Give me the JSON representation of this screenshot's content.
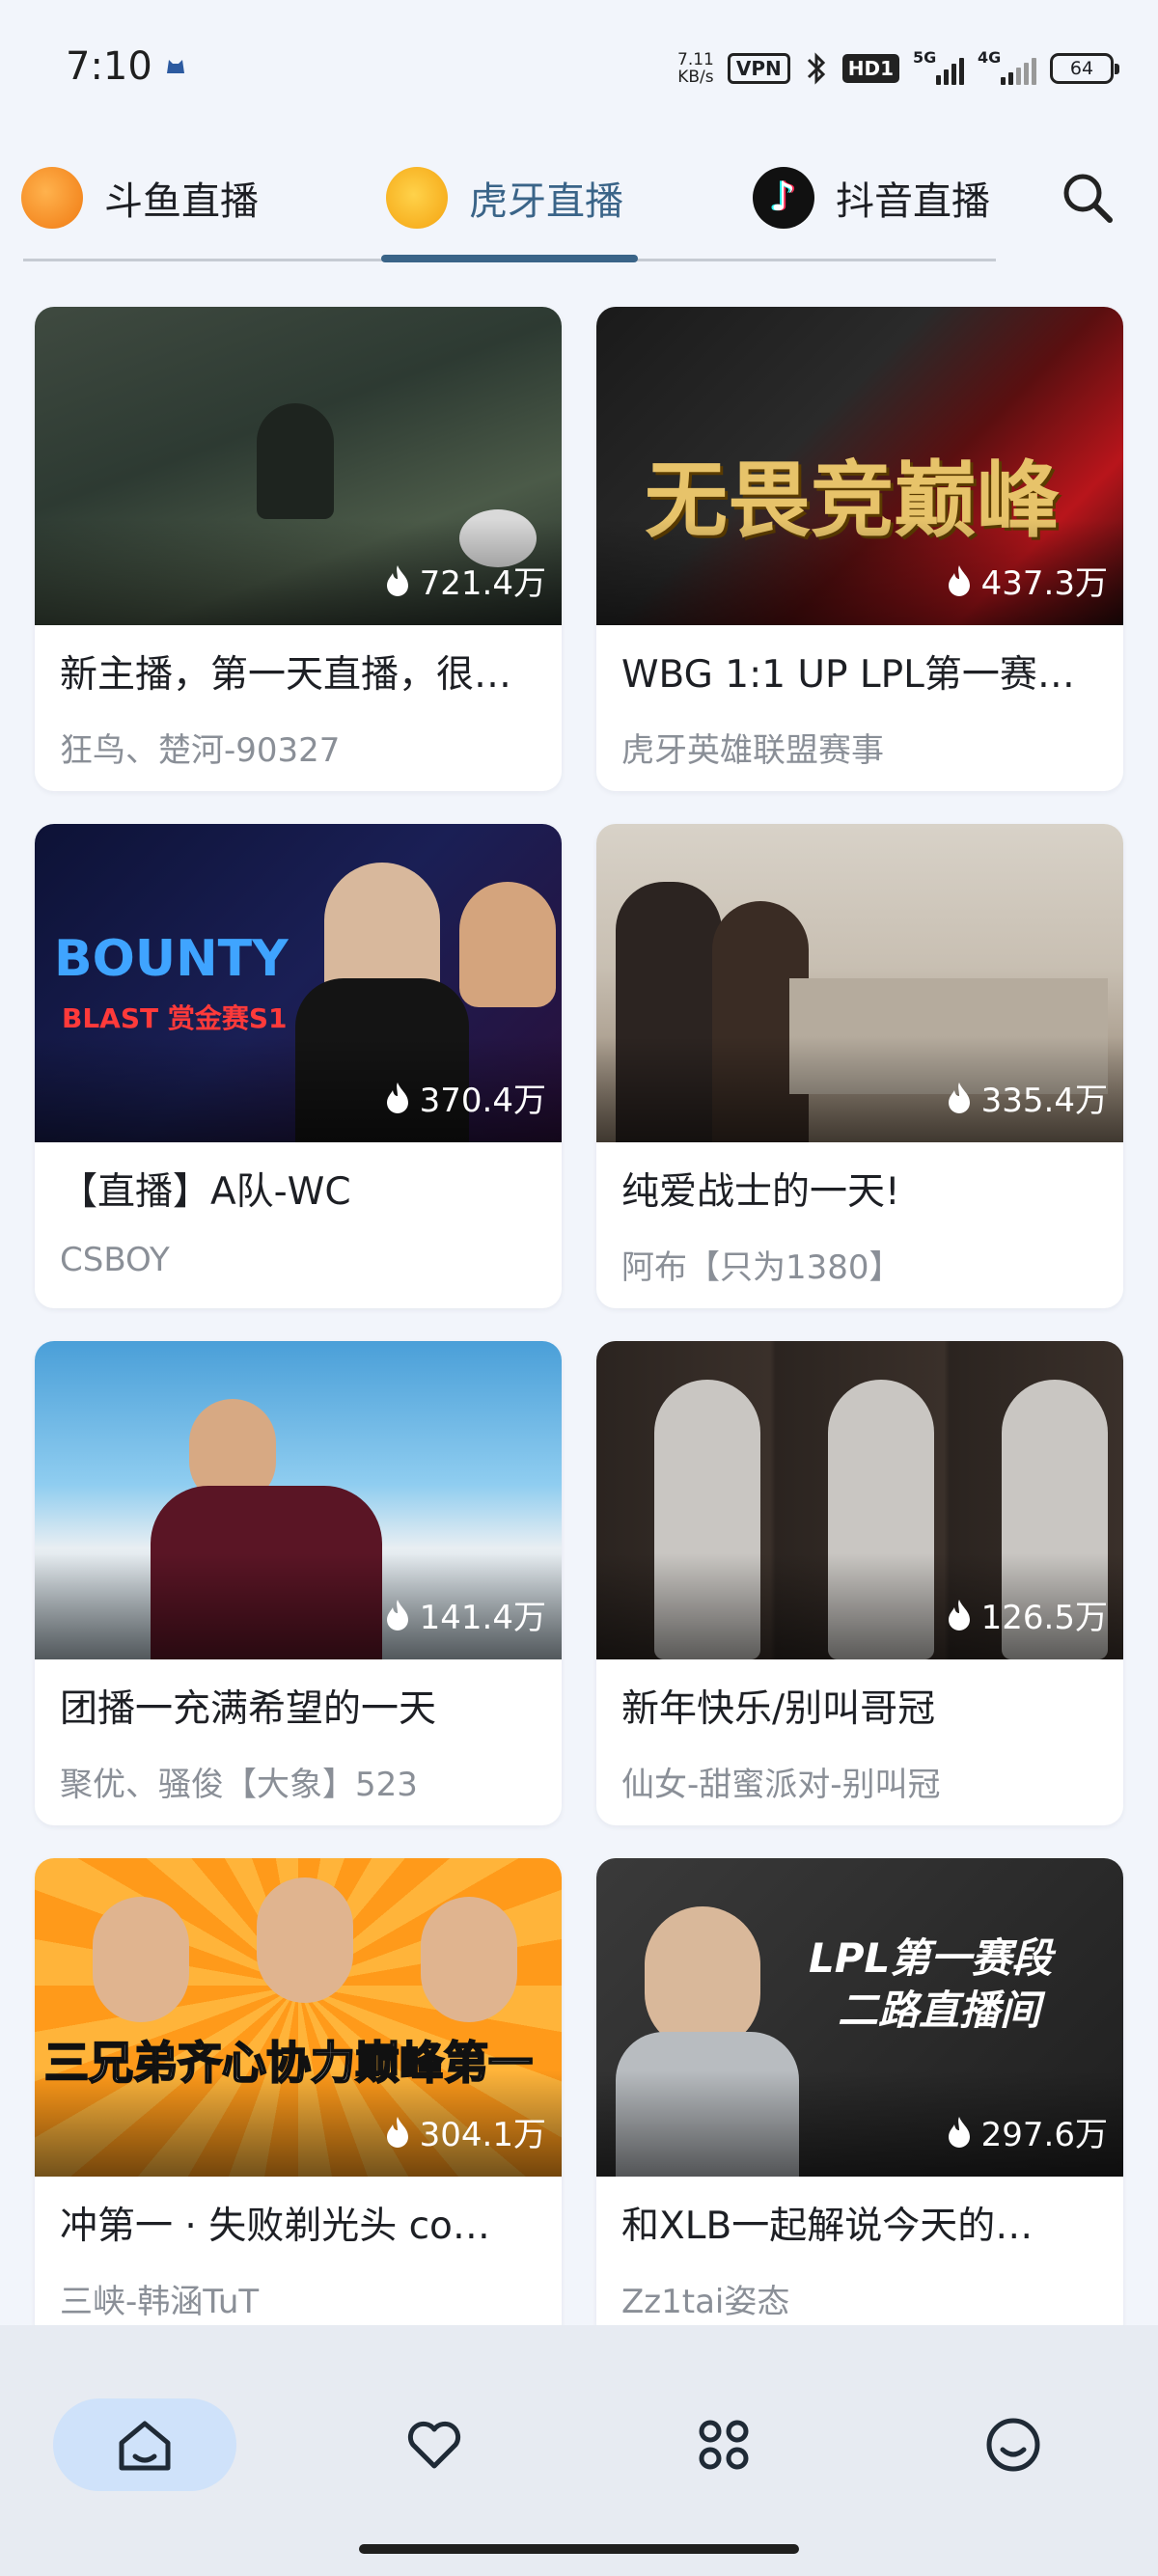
{
  "status_bar": {
    "time": "7:10",
    "net_speed_value": "7.11",
    "net_speed_unit": "KB/s",
    "vpn": "VPN",
    "hd": "HD1",
    "signal1_tag": "5G",
    "signal2_tag": "4G",
    "battery": "64"
  },
  "tabs": [
    {
      "label": "斗鱼直播",
      "icon": "douyu-logo-icon"
    },
    {
      "label": "虎牙直播",
      "icon": "huya-logo-icon",
      "selected": true
    },
    {
      "label": "抖音直播",
      "icon": "douyin-logo-icon"
    }
  ],
  "accent_color": "#3a6488",
  "cards": [
    {
      "title": "新主播，第一天直播，很…",
      "author": "狂鸟、楚河-90327",
      "viewers": "721.4万"
    },
    {
      "title": "WBG 1:1 UP LPL第一赛…",
      "author": "虎牙英雄联盟赛事",
      "viewers": "437.3万",
      "thumb_text": "无畏竞巅峰"
    },
    {
      "title": "【直播】A队-WC",
      "author": "CSBOY",
      "viewers": "370.4万",
      "thumb_text": "BOUNTY",
      "thumb_sub": "BLAST 赏金赛S1"
    },
    {
      "title": "纯爱战士的一天!",
      "author": "阿布【只为1380】",
      "viewers": "335.4万"
    },
    {
      "title": "团播一充满希望的一天",
      "author": "聚优、骚俊【大象】523",
      "viewers": "141.4万"
    },
    {
      "title": "新年快乐/别叫哥冠",
      "author": "仙女-甜蜜派对-别叫冠",
      "viewers": "126.5万"
    },
    {
      "title": "冲第一 · 失败剃光头 co…",
      "author": "三峡-韩涵TuT",
      "viewers": "304.1万",
      "thumb_text": "三兄弟齐心协力巅峰第一"
    },
    {
      "title": "和XLB一起解说今天的…",
      "author": "Zz1tai姿态",
      "viewers": "297.6万",
      "thumb_text": "LPL第一赛段",
      "thumb_sub": "二路直播间"
    }
  ],
  "bottom_nav": [
    {
      "icon": "home-icon",
      "selected": true
    },
    {
      "icon": "heart-icon"
    },
    {
      "icon": "apps-icon"
    },
    {
      "icon": "profile-icon"
    }
  ]
}
